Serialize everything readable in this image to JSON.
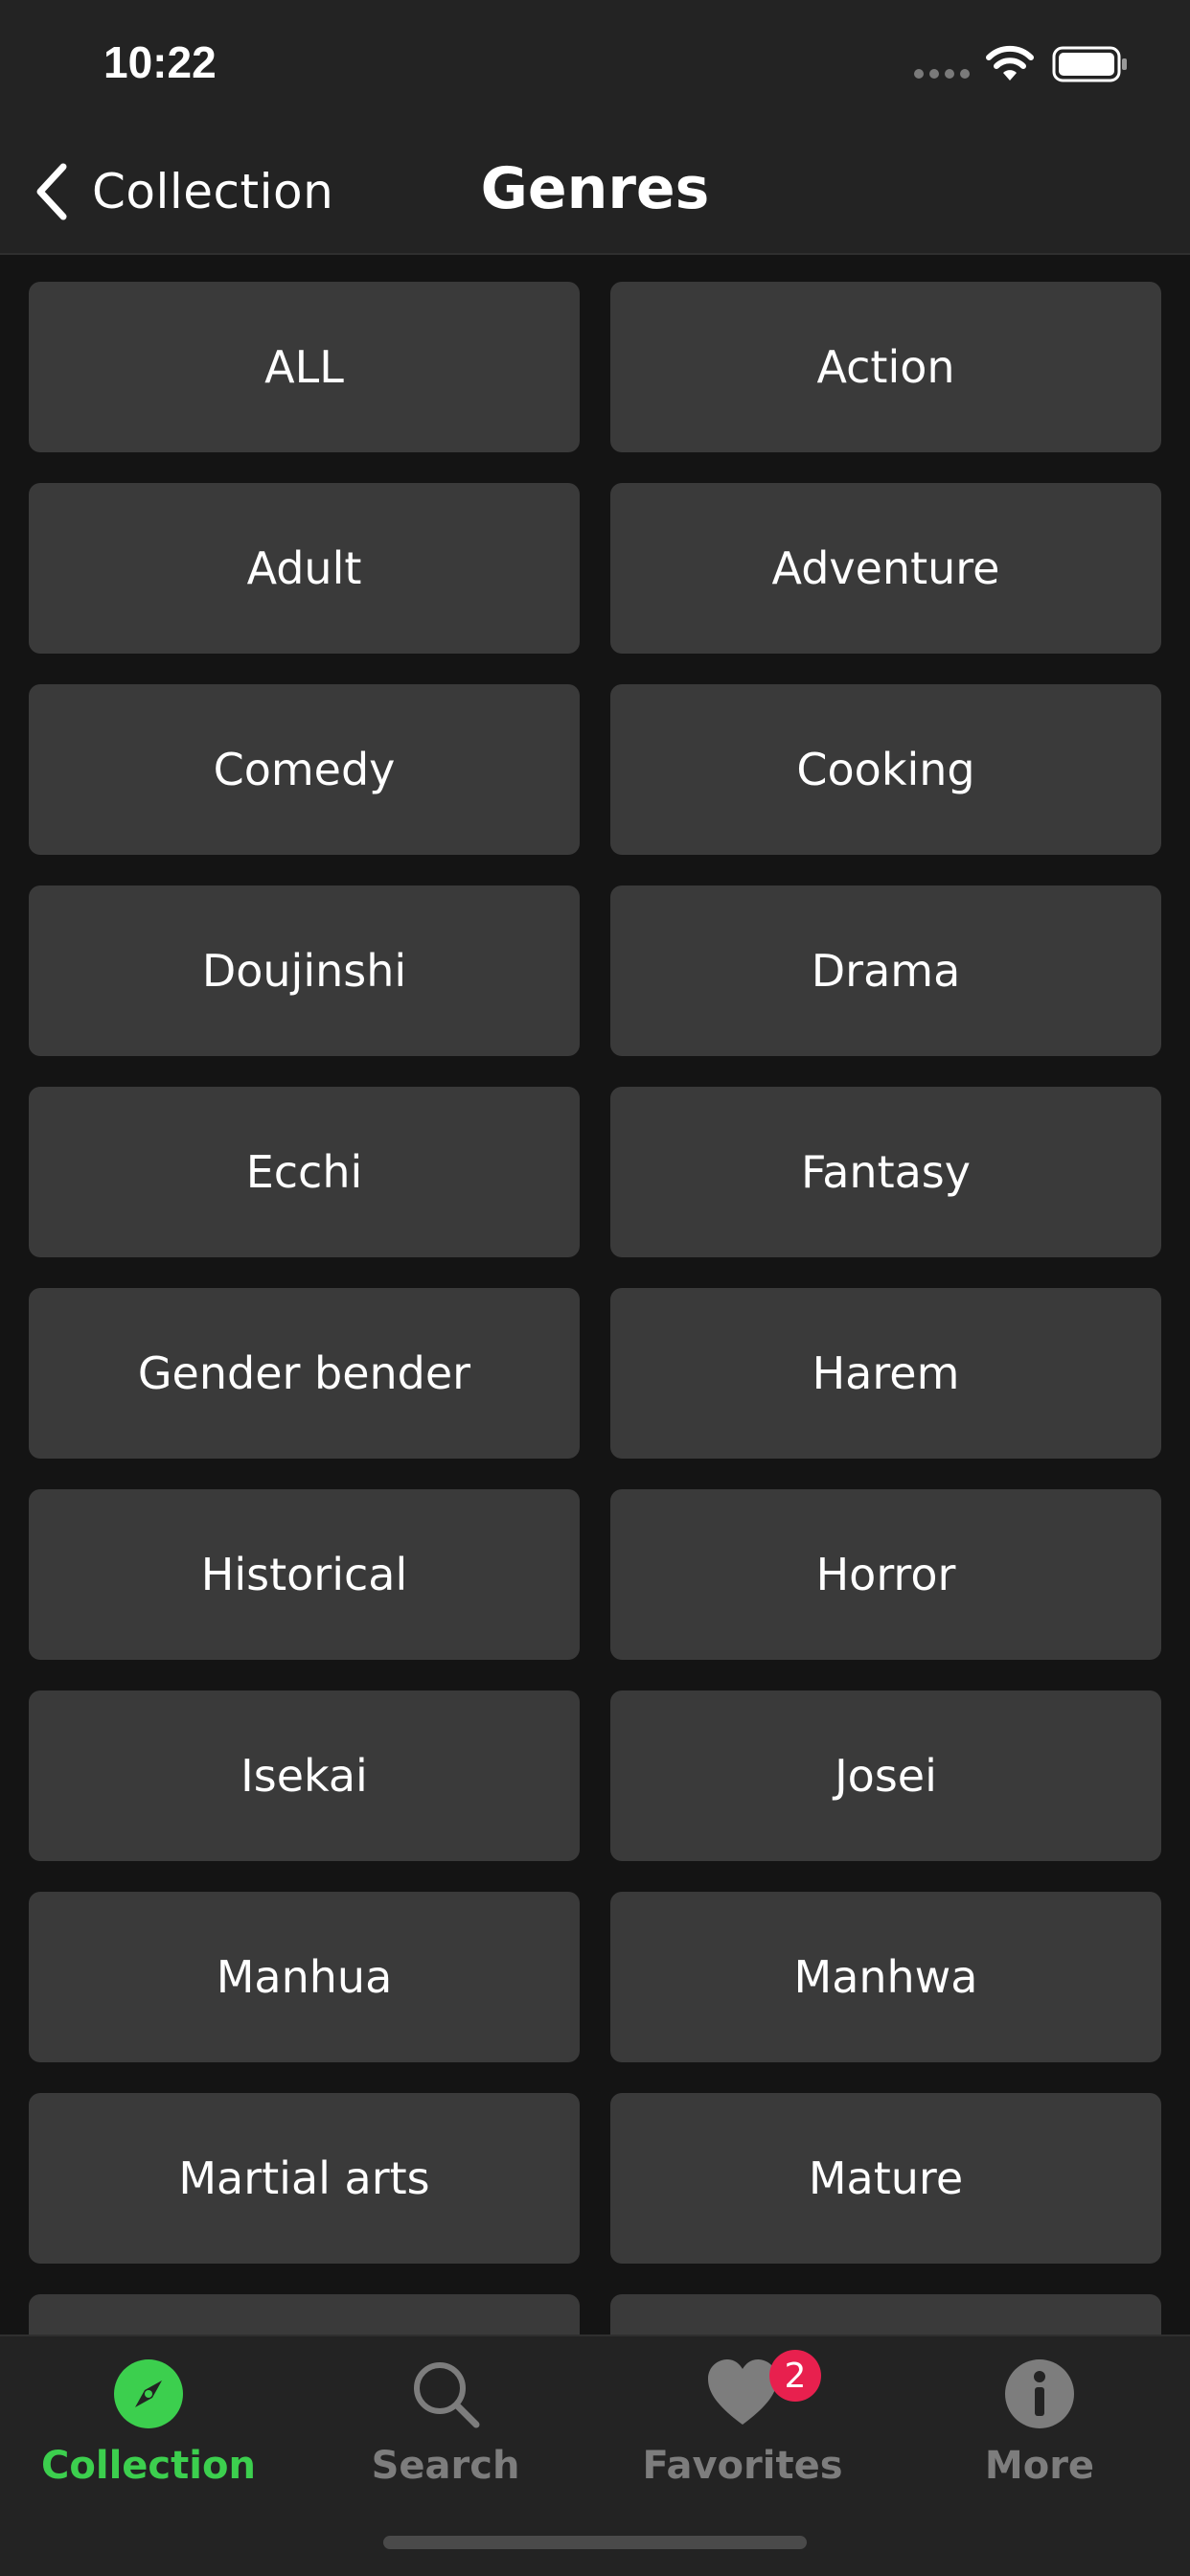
{
  "status_bar": {
    "time": "10:22"
  },
  "nav": {
    "back_label": "Collection",
    "title": "Genres"
  },
  "genres": [
    "ALL",
    "Action",
    "Adult",
    "Adventure",
    "Comedy",
    "Cooking",
    "Doujinshi",
    "Drama",
    "Ecchi",
    "Fantasy",
    "Gender bender",
    "Harem",
    "Historical",
    "Horror",
    "Isekai",
    "Josei",
    "Manhua",
    "Manhwa",
    "Martial arts",
    "Mature",
    "",
    ""
  ],
  "tab_bar": {
    "tabs": [
      {
        "label": "Collection",
        "icon": "compass-icon",
        "active": true
      },
      {
        "label": "Search",
        "icon": "magnifier-icon",
        "active": false
      },
      {
        "label": "Favorites",
        "icon": "heart-icon",
        "active": false,
        "badge": "2"
      },
      {
        "label": "More",
        "icon": "info-icon",
        "active": false
      }
    ]
  },
  "colors": {
    "accent": "#3ccf4e",
    "badge": "#e8204e",
    "tile": "#3a3a3a",
    "bar": "#232323",
    "background": "#141414"
  }
}
